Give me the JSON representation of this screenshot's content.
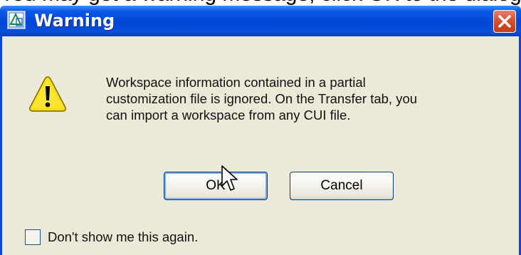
{
  "background_text": "You may get a warning message, click OK to the dialog",
  "window": {
    "title": "Warning"
  },
  "icons": {
    "app": "autocad-app-icon",
    "close": "close-icon",
    "warning": "warning-triangle-icon",
    "cursor": "mouse-pointer-icon"
  },
  "message": {
    "lines": [
      "Workspace information contained in a partial",
      "customization file is ignored. On the Transfer tab, you",
      "can import a workspace from any CUI file."
    ]
  },
  "buttons": {
    "ok": "OK",
    "cancel": "Cancel"
  },
  "checkbox": {
    "label": "Don't show me this again.",
    "checked": false
  },
  "colors": {
    "titlebar": "#0047d8",
    "dialog_bg": "#ece9d8",
    "close": "#d8502e",
    "warning_fill": "#f8e010"
  }
}
